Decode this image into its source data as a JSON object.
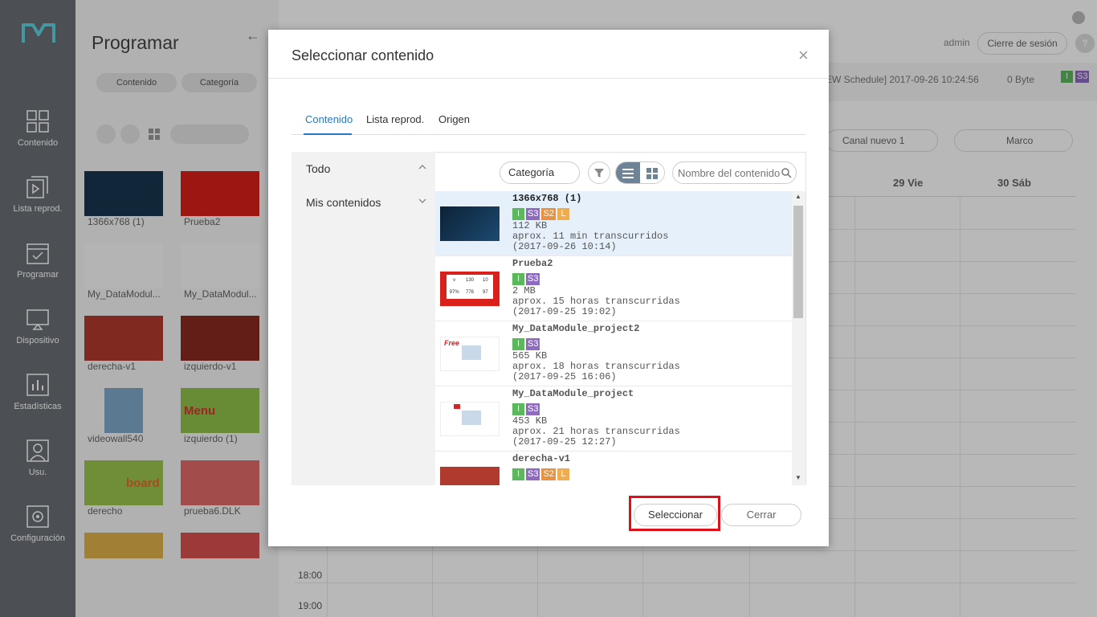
{
  "sidebar": {
    "items": [
      {
        "label": "Contenido",
        "icon": "grid-icon"
      },
      {
        "label": "Lista reprod.",
        "icon": "playlist-icon"
      },
      {
        "label": "Programar",
        "icon": "calendar-icon"
      },
      {
        "label": "Dispositivo",
        "icon": "monitor-icon"
      },
      {
        "label": "Estadísticas",
        "icon": "chart-icon"
      },
      {
        "label": "Usu.",
        "icon": "user-icon"
      },
      {
        "label": "Configuración",
        "icon": "gear-icon"
      }
    ]
  },
  "panel": {
    "title": "Programar",
    "pills": [
      "Contenido",
      "Categoría"
    ],
    "thumbs": [
      "1366x768 (1)",
      "Prueba2",
      "My_DataModul...",
      "My_DataModul...",
      "derecha-v1",
      "izquierdo-v1",
      "videowall540",
      "izquierdo (1)",
      "derecho",
      "prueba6.DLK"
    ],
    "thumb_texts": {
      "menu": "Menu",
      "board": "board"
    }
  },
  "header": {
    "user": "admin",
    "logout": "Cierre de sesión",
    "help": "?",
    "schedule_info": "EW Schedule] 2017-09-26 10:24:56",
    "size": "0 Byte",
    "badges": [
      "I",
      "S3"
    ]
  },
  "calendar": {
    "channel": "Canal nuevo 1",
    "frame": "Marco",
    "days": [
      "29 Vie",
      "30 Sáb"
    ],
    "times": [
      "18:00",
      "19:00"
    ]
  },
  "dialog": {
    "title": "Seleccionar contenido",
    "tabs": [
      "Contenido",
      "Lista reprod.",
      "Origen"
    ],
    "left_items": [
      "Todo",
      "Mis contenidos"
    ],
    "category": "Categoría",
    "search_placeholder": "Nombre del contenido",
    "rows": [
      {
        "name": "1366x768 (1)",
        "badges": [
          "I",
          "S3",
          "S2",
          "L"
        ],
        "size": "112 KB",
        "ago": "aprox. 11 min transcurridos",
        "date": "(2017-09-26 10:14)"
      },
      {
        "name": "Prueba2",
        "badges": [
          "I",
          "S3"
        ],
        "size": "2 MB",
        "ago": "aprox. 15 horas transcurridas",
        "date": "(2017-09-25 19:02)"
      },
      {
        "name": "My_DataModule_project2",
        "badges": [
          "I",
          "S3"
        ],
        "size": "565 KB",
        "ago": "aprox. 18 horas transcurridas",
        "date": "(2017-09-25 16:06)"
      },
      {
        "name": "My_DataModule_project",
        "badges": [
          "I",
          "S3"
        ],
        "size": "453 KB",
        "ago": "aprox. 21 horas transcurridas",
        "date": "(2017-09-25 12:27)"
      },
      {
        "name": "derecha-v1",
        "badges": [
          "I",
          "S3",
          "S2",
          "L"
        ],
        "size": "",
        "ago": "",
        "date": ""
      }
    ],
    "prueba_cells": [
      "v",
      "130",
      "10",
      "97%",
      "776",
      "97"
    ],
    "select_label": "Seleccionar",
    "close_label": "Cerrar"
  }
}
